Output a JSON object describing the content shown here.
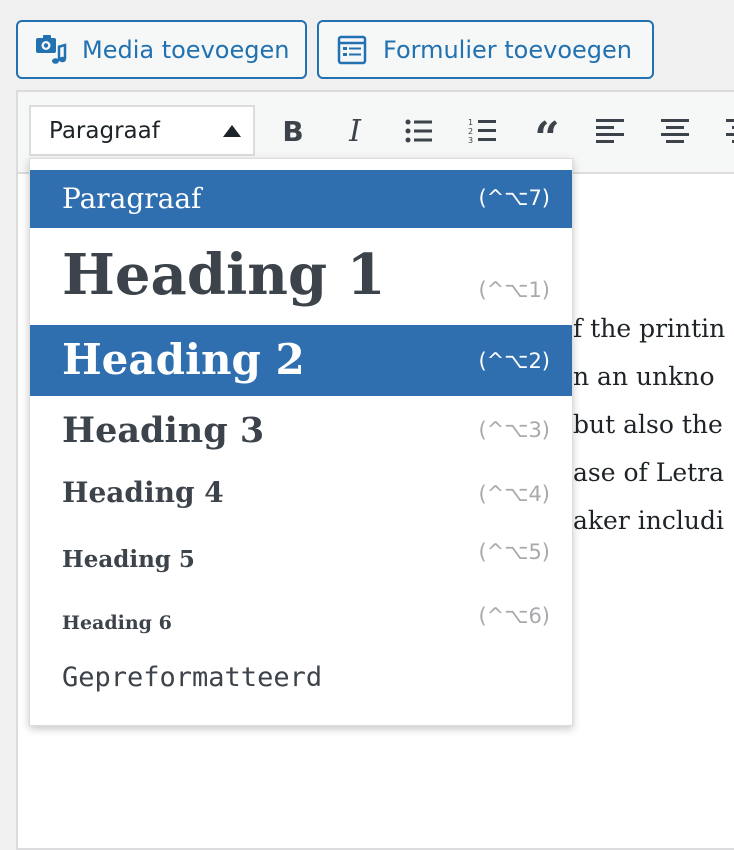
{
  "top_buttons": {
    "media_label": "Media toevoegen",
    "form_label": "Formulier toevoegen"
  },
  "toolbar": {
    "format_selected": "Paragraaf",
    "icons": [
      "bold-icon",
      "italic-icon",
      "bulleted-list-icon",
      "numbered-list-icon",
      "blockquote-icon",
      "align-left-icon",
      "align-center-icon",
      "align-right-icon"
    ]
  },
  "content_lines": [
    "f the printin",
    "n an unkno",
    " but also the",
    "ase of Letra",
    "aker includi"
  ],
  "format_menu": {
    "items": [
      {
        "label": "Paragraaf",
        "shortcut": "(^⌥7)"
      },
      {
        "label": "Heading 1",
        "shortcut": "(^⌥1)"
      },
      {
        "label": "Heading 2",
        "shortcut": "(^⌥2)"
      },
      {
        "label": "Heading 3",
        "shortcut": "(^⌥3)"
      },
      {
        "label": "Heading 4",
        "shortcut": "(^⌥4)"
      },
      {
        "label": "Heading 5",
        "shortcut": "(^⌥5)"
      },
      {
        "label": "Heading 6",
        "shortcut": "(^⌥6)"
      },
      {
        "label": "Gepreformatteerd",
        "shortcut": ""
      }
    ]
  },
  "colors": {
    "accent": "#2271b1",
    "menu_highlight": "#2f6fb0",
    "text": "#3c434a",
    "shortcut": "#a7aaad"
  }
}
